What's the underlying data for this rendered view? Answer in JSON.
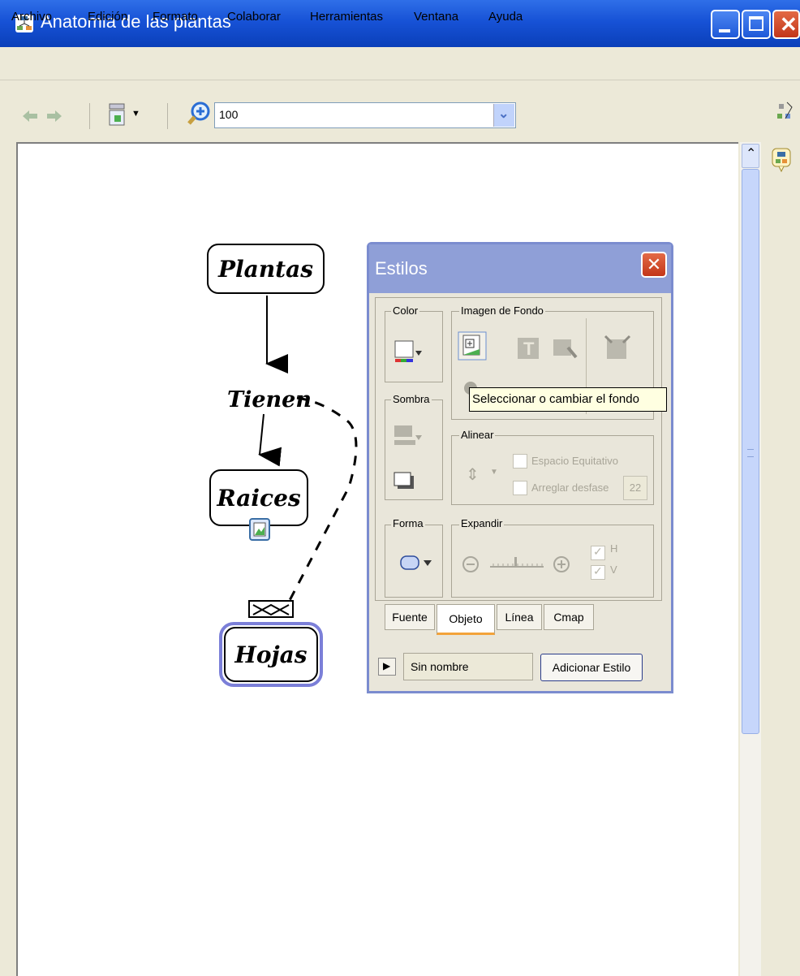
{
  "window": {
    "title": "Anatomia de las plantas"
  },
  "menu": [
    "Archivo",
    "Edición",
    "Formato",
    "Colaborar",
    "Herramientas",
    "Ventana",
    "Ayuda"
  ],
  "toolbar": {
    "zoom_value": "100"
  },
  "concepts": {
    "plantas": "Plantas",
    "tienen": "Tienen",
    "raices": "Raices",
    "hojas": "Hojas"
  },
  "styles_panel": {
    "title": "Estilos",
    "groups": {
      "color": "Color",
      "background_image": "Imagen de Fondo",
      "shadow": "Sombra",
      "align": "Alinear",
      "shape": "Forma",
      "expand": "Expandir"
    },
    "align": {
      "equal_spacing": "Espacio Equitativo",
      "fix_offset": "Arreglar desfase",
      "offset_value": "22"
    },
    "expand": {
      "h": "H",
      "v": "V"
    },
    "tabs": [
      "Fuente",
      "Objeto",
      "Línea",
      "Cmap"
    ],
    "active_tab": "Objeto",
    "style_name": "Sin nombre",
    "add_style_button": "Adicionar Estilo",
    "tooltip": "Seleccionar o cambiar el fondo"
  },
  "colors": {
    "title_bar": "#0a3fb9",
    "panel_title": "#8f9fd7",
    "selection": "#7b7fd8"
  }
}
